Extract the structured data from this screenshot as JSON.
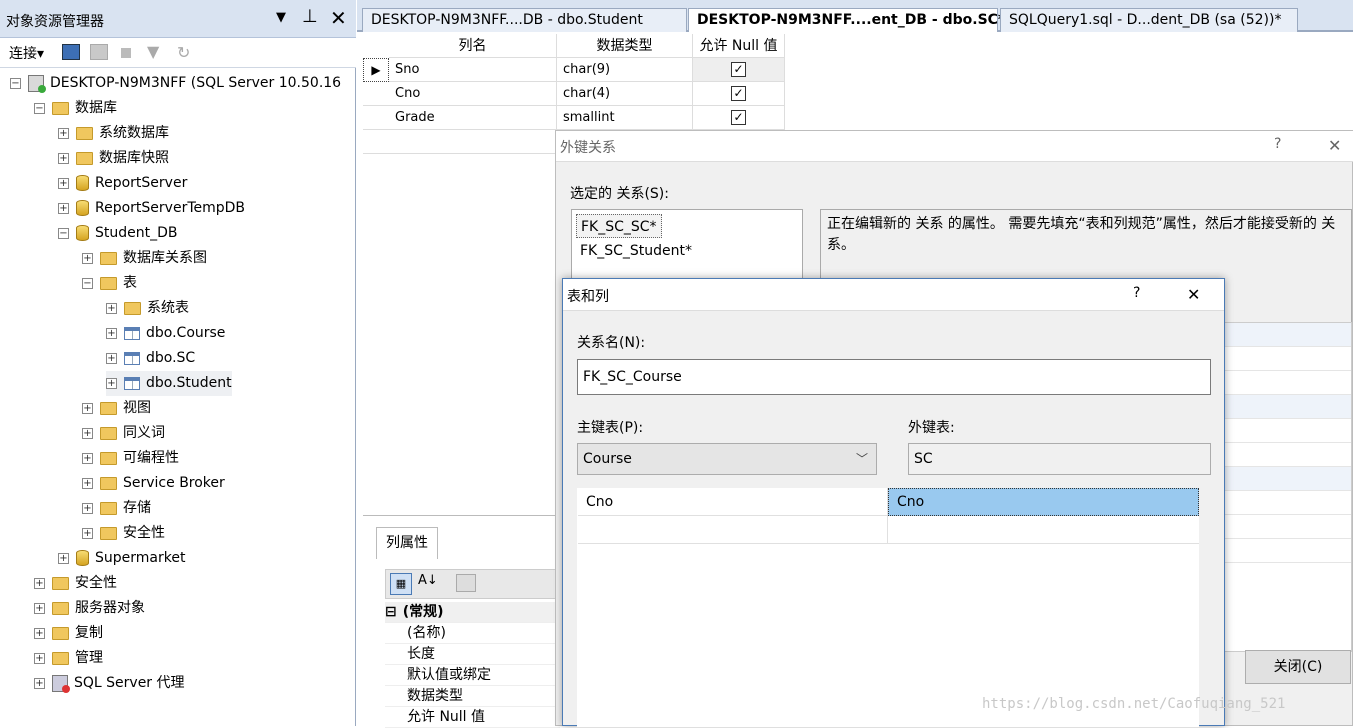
{
  "object_explorer": {
    "title": "对象资源管理器",
    "pin": "ᵖ",
    "close": "✕",
    "toolbar": {
      "connect": "连接▾"
    },
    "tree": [
      {
        "label": "DESKTOP-N9M3NFF (SQL Server 10.50.16",
        "icon": "server-icon",
        "expander": "⊟"
      },
      {
        "label": "数据库",
        "icon": "folder-icon",
        "expander": "⊟"
      },
      {
        "label": "系统数据库",
        "icon": "folder-icon",
        "expander": "⊞"
      },
      {
        "label": "数据库快照",
        "icon": "folder-icon",
        "expander": "⊞"
      },
      {
        "label": "ReportServer",
        "icon": "database-icon",
        "expander": "⊞"
      },
      {
        "label": "ReportServerTempDB",
        "icon": "database-icon",
        "expander": "⊞"
      },
      {
        "label": "Student_DB",
        "icon": "database-icon",
        "expander": "⊟"
      },
      {
        "label": "数据库关系图",
        "icon": "folder-icon",
        "expander": "⊞"
      },
      {
        "label": "表",
        "icon": "folder-icon",
        "expander": "⊟"
      },
      {
        "label": "系统表",
        "icon": "folder-icon",
        "expander": "⊞"
      },
      {
        "label": "dbo.Course",
        "icon": "table-icon",
        "expander": "⊞"
      },
      {
        "label": "dbo.SC",
        "icon": "table-icon",
        "expander": "⊞"
      },
      {
        "label": "dbo.Student",
        "icon": "table-icon",
        "expander": "⊞"
      },
      {
        "label": "视图",
        "icon": "folder-icon",
        "expander": "⊞"
      },
      {
        "label": "同义词",
        "icon": "folder-icon",
        "expander": "⊞"
      },
      {
        "label": "可编程性",
        "icon": "folder-icon",
        "expander": "⊞"
      },
      {
        "label": "Service Broker",
        "icon": "folder-icon",
        "expander": "⊞"
      },
      {
        "label": "存储",
        "icon": "folder-icon",
        "expander": "⊞"
      },
      {
        "label": "安全性",
        "icon": "folder-icon",
        "expander": "⊞"
      },
      {
        "label": "Supermarket",
        "icon": "database-icon",
        "expander": "⊞"
      },
      {
        "label": "安全性",
        "icon": "folder-icon",
        "expander": "⊞"
      },
      {
        "label": "服务器对象",
        "icon": "folder-icon",
        "expander": "⊞"
      },
      {
        "label": "复制",
        "icon": "folder-icon",
        "expander": "⊞"
      },
      {
        "label": "管理",
        "icon": "folder-icon",
        "expander": "⊞"
      },
      {
        "label": "SQL Server 代理",
        "icon": "agent-icon",
        "expander": "⊞"
      }
    ]
  },
  "tabs": [
    {
      "label": "DESKTOP-N9M3NFF....DB - dbo.Student"
    },
    {
      "label": "DESKTOP-N9M3NFF....ent_DB - dbo.SC*"
    },
    {
      "label": "SQLQuery1.sql - D...dent_DB (sa (52))*"
    }
  ],
  "designer": {
    "headers": {
      "name": "列名",
      "type": "数据类型",
      "null": "允许 Null 值"
    },
    "rows": [
      {
        "name": "Sno",
        "type": "char(9)",
        "null": "✓"
      },
      {
        "name": "Cno",
        "type": "char(4)",
        "null": "✓"
      },
      {
        "name": "Grade",
        "type": "smallint",
        "null": "✓"
      }
    ]
  },
  "column_properties": {
    "tab": "列属性",
    "section": "(常规)",
    "items": [
      "(名称)",
      "长度",
      "默认值或绑定",
      "数据类型",
      "允许 Null 值"
    ]
  },
  "fk_dialog": {
    "title": "外键关系",
    "help": "?",
    "close": "✕",
    "selected_label": "选定的 关系(S):",
    "relations": [
      "FK_SC_SC*",
      "FK_SC_Student*"
    ],
    "info": "正在编辑新的 关系 的属性。 需要先填充“表和列规范”属性，然后才能接受新的 关系。",
    "close_button": "关闭(C)"
  },
  "tc_dialog": {
    "title": "表和列",
    "help": "?",
    "close": "✕",
    "relation_name_label": "关系名(N):",
    "relation_name": "FK_SC_Course",
    "pk_label": "主键表(P):",
    "pk_value": "Course",
    "fk_label": "外键表:",
    "fk_value": "SC",
    "mapping": [
      {
        "pk": "Cno",
        "fk": "Cno"
      },
      {
        "pk": "",
        "fk": ""
      }
    ]
  },
  "watermark": "https://blog.csdn.net/Caofuqiang_521"
}
